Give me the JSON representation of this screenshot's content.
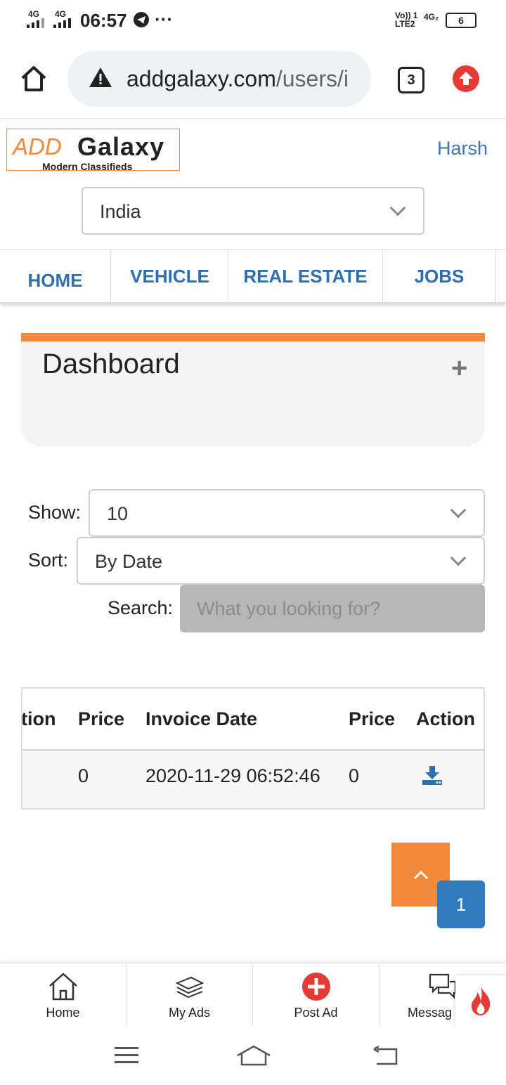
{
  "status_bar": {
    "time": "06:57",
    "net1": "4G",
    "net2": "4G",
    "dots": "···",
    "volte": "Vo)) 1",
    "lte": "LTE2",
    "sim2": "4G₂",
    "battery": "6"
  },
  "browser": {
    "url_domain": "addgalaxy.com",
    "url_path": "/users/i",
    "tab_count": "3"
  },
  "site": {
    "logo_add": "ADD",
    "logo_galaxy": "Galaxy",
    "logo_tagline": "Modern Classifieds",
    "user_name": "Harsh",
    "country": "India"
  },
  "nav": {
    "items": [
      "HOME",
      "VEHICLE",
      "REAL ESTATE",
      "JOBS"
    ]
  },
  "dashboard": {
    "title": "Dashboard",
    "expand": "+"
  },
  "filters": {
    "show_label": "Show:",
    "show_value": "10",
    "sort_label": "Sort:",
    "sort_value": "By Date",
    "search_label": "Search:",
    "search_placeholder": "What you looking for?"
  },
  "table": {
    "headers": [
      "tion",
      "Price",
      "Invoice Date",
      "Price",
      "Action"
    ],
    "rows": [
      {
        "col1": "",
        "price": "0",
        "invoice_date": "2020-11-29 06:52:46",
        "price2": "0",
        "action_icon": "download-icon"
      }
    ]
  },
  "pagination": {
    "current_page": "1"
  },
  "bottom_nav": {
    "items": [
      "Home",
      "My Ads",
      "Post Ad",
      "Messag"
    ]
  },
  "colors": {
    "brand_orange": "#f28a3b",
    "link_blue": "#2f6fae",
    "page_blue": "#2f7bbd",
    "alert_red": "#e53935"
  }
}
